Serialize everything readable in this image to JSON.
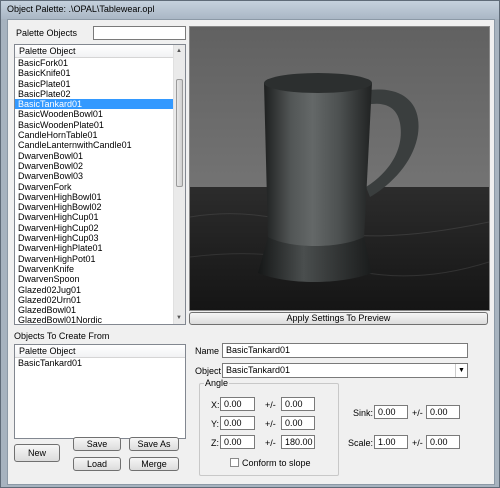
{
  "window": {
    "title": "Object Palette:  .\\OPAL\\Tablewear.opl"
  },
  "palette": {
    "label": "Palette Objects",
    "filter_value": "",
    "column_header": "Palette Object",
    "items": [
      "BasicFork01",
      "BasicKnife01",
      "BasicPlate01",
      "BasicPlate02",
      "BasicTankard01",
      "BasicWoodenBowl01",
      "BasicWoodenPlate01",
      "CandleHornTable01",
      "CandleLanternwithCandle01",
      "DwarvenBowl01",
      "DwarvenBowl02",
      "DwarvenBowl03",
      "DwarvenFork",
      "DwarvenHighBowl01",
      "DwarvenHighBowl02",
      "DwarvenHighCup01",
      "DwarvenHighCup02",
      "DwarvenHighCup03",
      "DwarvenHighPlate01",
      "DwarvenHighPot01",
      "DwarvenKnife",
      "DwarvenSpoon",
      "Glazed02Jug01",
      "Glazed02Urn01",
      "GlazedBowl01",
      "GlazedBowl01Nordic"
    ],
    "selected_index": 4
  },
  "create_from": {
    "label": "Objects To Create From",
    "column_header": "Palette Object",
    "items": [
      "BasicTankard01"
    ]
  },
  "buttons": {
    "new": "New",
    "save": "Save",
    "save_as": "Save As",
    "load": "Load",
    "merge": "Merge",
    "apply": "Apply Settings To Preview"
  },
  "form": {
    "name_label": "Name",
    "name_value": "BasicTankard01",
    "object_label": "Object",
    "object_value": "BasicTankard01",
    "angle_label": "Angle",
    "x_label": "X:",
    "x_value": "0.00",
    "x_pm_label": "+/-",
    "x_pm_value": "0.00",
    "y_label": "Y:",
    "y_value": "0.00",
    "y_pm_label": "+/-",
    "y_pm_value": "0.00",
    "z_label": "Z:",
    "z_value": "0.00",
    "z_pm_label": "+/-",
    "z_pm_value": "180.00",
    "conform_label": "Conform to slope",
    "conform_checked": false,
    "sink_label": "Sink:",
    "sink_value": "0.00",
    "sink_pm_label": "+/-",
    "sink_pm_value": "0.00",
    "scale_label": "Scale:",
    "scale_value": "1.00",
    "scale_pm_label": "+/-",
    "scale_pm_value": "0.00"
  },
  "icons": {
    "dropdown": "chevron-down-icon",
    "scroll_up": "scroll-up-icon",
    "scroll_down": "scroll-down-icon"
  }
}
